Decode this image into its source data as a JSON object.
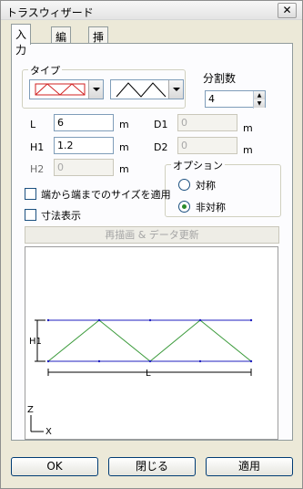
{
  "window": {
    "title": "トラスウィザード",
    "close_glyph": "✕"
  },
  "tabs": [
    "入力",
    "編集",
    "挿入"
  ],
  "type_group": {
    "label": "タイプ"
  },
  "divisions": {
    "label": "分割数",
    "value": "4"
  },
  "fields": {
    "L": {
      "label": "L",
      "value": "6",
      "unit": "m"
    },
    "H1": {
      "label": "H1",
      "value": "1.2",
      "unit": "m"
    },
    "H2": {
      "label": "H2",
      "value": "0",
      "unit": "m"
    },
    "D1": {
      "label": "D1",
      "value": "0",
      "unit": "m"
    },
    "D2": {
      "label": "D2",
      "value": "0",
      "unit": "m"
    }
  },
  "options": {
    "label": "オプション",
    "symmetric": "対称",
    "asymmetric": "非対称",
    "selected": "非対称"
  },
  "checkboxes": {
    "end_to_end": "端から端までのサイズを適用",
    "show_dimensions": "寸法表示"
  },
  "redraw_label": "再描画 & データ更新",
  "preview": {
    "h_label": "H1",
    "l_label": "L",
    "z_axis": "Z",
    "x_axis": "X"
  },
  "buttons": {
    "ok": "OK",
    "close": "閉じる",
    "apply": "適用"
  },
  "colors": {
    "chord": "#1f1fbf",
    "web": "#3a9a3a",
    "type_icon": "#d02020"
  }
}
